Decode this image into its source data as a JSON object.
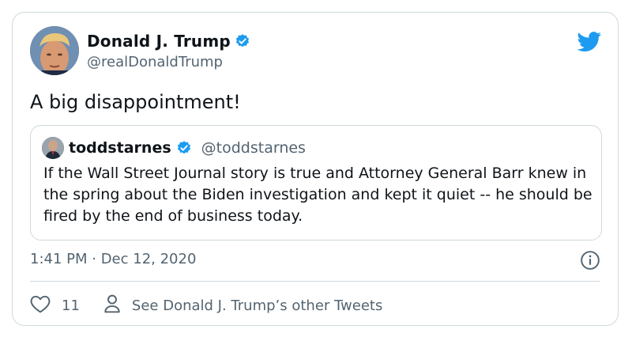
{
  "author": {
    "display_name": "Donald J. Trump",
    "handle": "@realDonaldTrump",
    "verified_icon": "verified-badge-icon"
  },
  "tweet": {
    "text": "A big disappointment!",
    "timestamp": "1:41 PM · Dec 12, 2020"
  },
  "quoted_tweet": {
    "display_name": "toddstarnes",
    "handle": "@toddstarnes",
    "text": "If the Wall Street Journal story is true and Attorney General Barr knew in the spring about the Biden investigation and kept it quiet -- he should be fired by the end of business today."
  },
  "actions": {
    "like_count": "11",
    "other_tweets_label": "See Donald J. Trump’s other Tweets"
  },
  "icons": {
    "brand": "twitter-bird-icon",
    "info": "info-icon",
    "like": "heart-icon",
    "profile": "person-icon"
  },
  "colors": {
    "brand_blue": "#1d9bf0",
    "secondary_text": "#536471",
    "border": "#cfd9de"
  }
}
